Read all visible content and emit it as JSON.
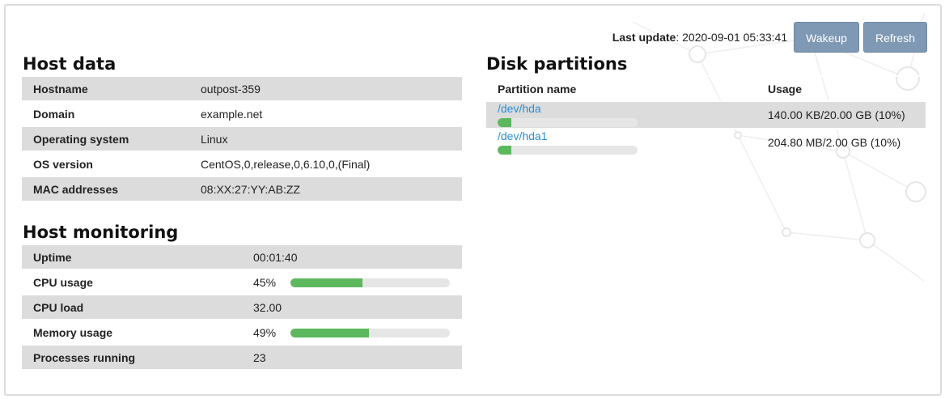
{
  "header": {
    "last_update_label": "Last update",
    "last_update_value": ": 2020-09-01 05:33:41",
    "wakeup_label": "Wakeup",
    "refresh_label": "Refresh"
  },
  "host_data": {
    "title": "Host data",
    "rows": [
      {
        "label": "Hostname",
        "value": "outpost-359"
      },
      {
        "label": "Domain",
        "value": "example.net"
      },
      {
        "label": "Operating system",
        "value": "Linux"
      },
      {
        "label": "OS version",
        "value": "CentOS,0,release,0,6.10,0,(Final)"
      },
      {
        "label": "MAC addresses",
        "value": "08:XX:27:YY:AB:ZZ"
      }
    ]
  },
  "host_monitoring": {
    "title": "Host monitoring",
    "rows": [
      {
        "label": "Uptime",
        "value": "00:01:40"
      },
      {
        "label": "CPU usage",
        "value": "45%",
        "percent": 45
      },
      {
        "label": "CPU load",
        "value": "32.00"
      },
      {
        "label": "Memory usage",
        "value": "49%",
        "percent": 49
      },
      {
        "label": "Processes running",
        "value": "23"
      }
    ]
  },
  "disk_partitions": {
    "title": "Disk partitions",
    "col_name": "Partition name",
    "col_usage": "Usage",
    "rows": [
      {
        "name": "/dev/hda",
        "usage": "140.00 KB/20.00 GB (10%)",
        "percent": 10
      },
      {
        "name": "/dev/hda1",
        "usage": "204.80 MB/2.00 GB (10%)",
        "percent": 10
      }
    ]
  },
  "colors": {
    "button": "#7f98b3",
    "bar_fill": "#5cb85c",
    "link": "#2a8fd4",
    "row_stripe": "#dcdcdc"
  }
}
